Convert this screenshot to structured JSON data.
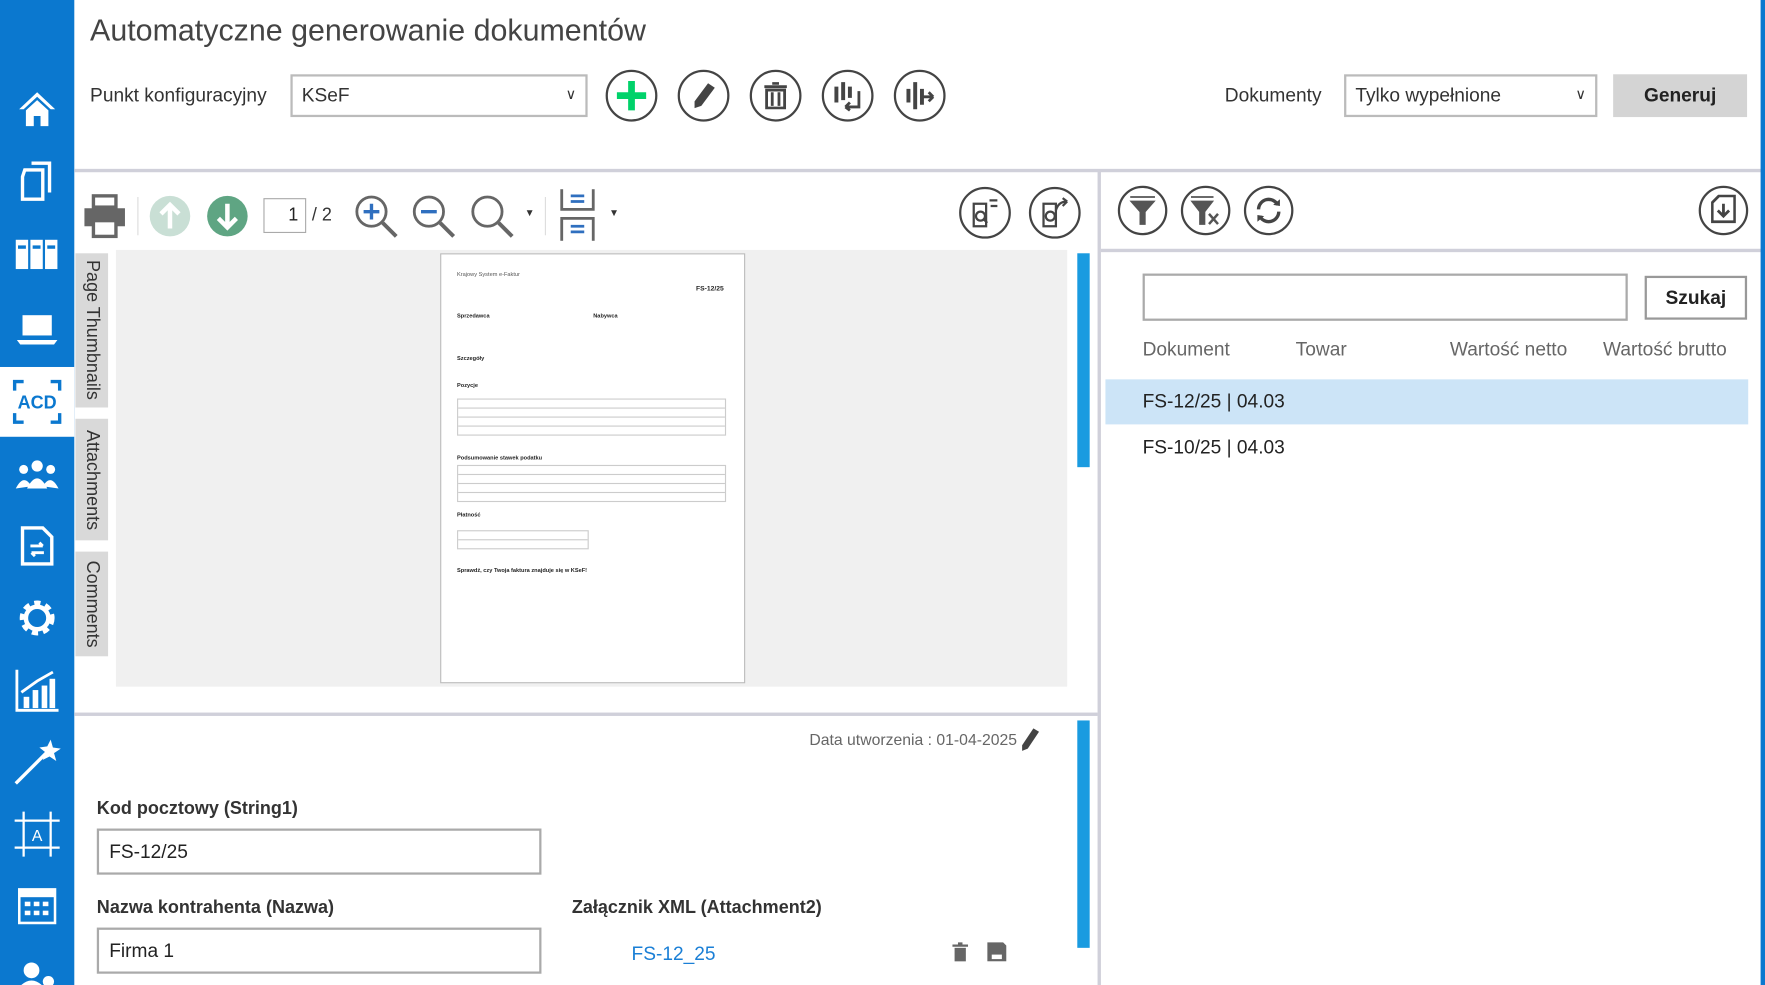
{
  "header": {
    "title": "Automatyczne generowanie dokumentów",
    "config_label": "Punkt konfiguracyjny",
    "config_value": "KSeF",
    "documents_label": "Dokumenty",
    "documents_value": "Tylko wypełnione",
    "generate_label": "Generuj"
  },
  "viewer": {
    "page_current": "1",
    "page_total": "/ 2",
    "tabs": [
      "Page Thumbnails",
      "Attachments",
      "Comments"
    ]
  },
  "doc": {
    "brand": "Krajowy System e-Faktur",
    "number": "FS-12/25",
    "seller": "Sprzedawca",
    "buyer": "Nabywca",
    "details": "Szczegóły",
    "positions": "Pozycje",
    "tax_summary": "Podsumowanie stawek podatku",
    "payment": "Płatność",
    "check": "Sprawdź, czy Twoja faktura znajduje się w KSeF!"
  },
  "form": {
    "created": "Data utworzenia : 01-04-2025",
    "postal_label": "Kod pocztowy (String1)",
    "postal_value": "FS-12/25",
    "name_label": "Nazwa kontrahenta (Nazwa)",
    "name_value": "Firma 1",
    "xml_label": "Załącznik XML (Attachment2)",
    "xml_link": "FS-12_25"
  },
  "search": {
    "value": "",
    "button": "Szukaj"
  },
  "list": {
    "columns": [
      "Dokument",
      "Towar",
      "Wartość netto",
      "Wartość brutto"
    ],
    "rows": [
      "FS-12/25 | 04.03",
      "FS-10/25 | 04.03"
    ]
  },
  "colors": {
    "sidebar": "#0b78cf",
    "selected_row": "#cce4f7",
    "accent_green": "#00d26a",
    "link": "#1a7fd6"
  }
}
